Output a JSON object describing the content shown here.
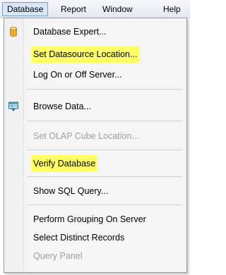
{
  "menubar": {
    "items": [
      {
        "label": "Database",
        "active": true
      },
      {
        "label": "Report"
      },
      {
        "label": "Window"
      },
      {
        "label": "Help"
      }
    ]
  },
  "dropdown": {
    "items": [
      {
        "label": "Database Expert...",
        "icon": "database-icon",
        "enabled": true,
        "highlighted": false
      },
      {
        "label": "Set Datasource Location...",
        "enabled": true,
        "highlighted": true
      },
      {
        "label": "Log On or Off Server...",
        "enabled": true,
        "highlighted": false
      },
      {
        "label": "Browse Data...",
        "icon": "browse-data-icon",
        "enabled": true,
        "highlighted": false
      },
      {
        "label": "Set OLAP Cube Location...",
        "enabled": false,
        "highlighted": false
      },
      {
        "label": "Verify Database",
        "enabled": true,
        "highlighted": true
      },
      {
        "label": "Show SQL Query...",
        "enabled": true,
        "highlighted": false
      },
      {
        "label": "Perform Grouping On Server",
        "enabled": true,
        "highlighted": false
      },
      {
        "label": "Select Distinct Records",
        "enabled": true,
        "highlighted": false
      },
      {
        "label": "Query Panel",
        "enabled": false,
        "highlighted": false
      }
    ]
  },
  "colors": {
    "highlight": "#ffff66",
    "disabled_text": "#9e9e9e",
    "menubar_active": "#d7e6f8"
  }
}
